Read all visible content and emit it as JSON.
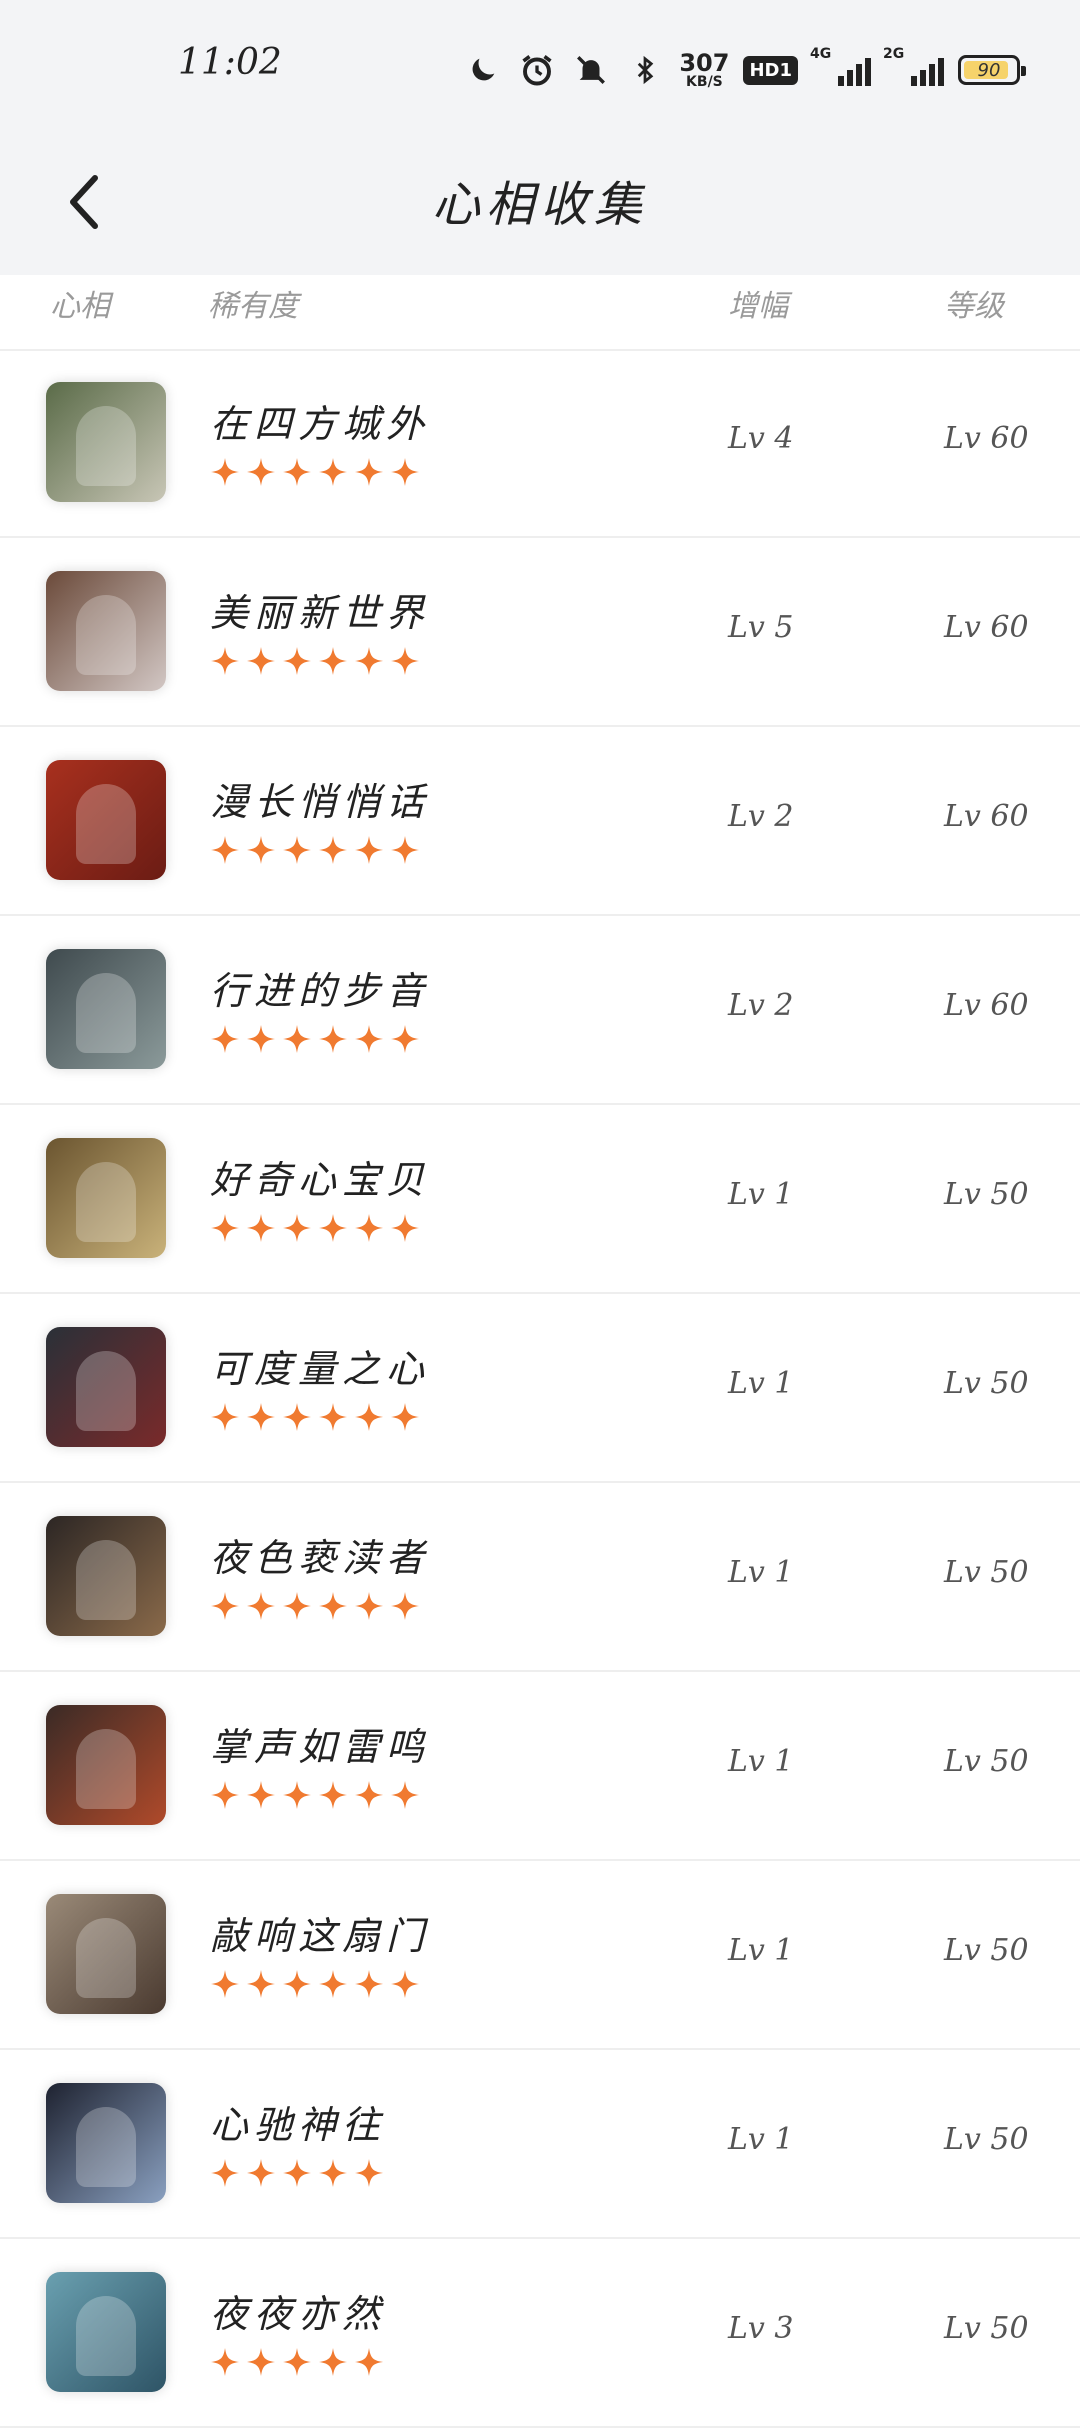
{
  "status_bar": {
    "time": "11:02",
    "net_speed_value": "307",
    "net_speed_unit": "KB/S",
    "hd_label": "HD1",
    "signal1_label": "4G",
    "signal2_label": "2G",
    "battery": "90"
  },
  "header": {
    "title": "心相收集"
  },
  "columns": {
    "icon": "心相",
    "rarity": "稀有度",
    "boost": "增幅",
    "level": "等级"
  },
  "star_color": "#f07a30",
  "items": [
    {
      "name": "在四方城外",
      "stars": 6,
      "boost": "Lv 4",
      "level": "Lv 60",
      "avatar_colors": [
        "#5a6b48",
        "#c8c6b6"
      ]
    },
    {
      "name": "美丽新世界",
      "stars": 6,
      "boost": "Lv 5",
      "level": "Lv 60",
      "avatar_colors": [
        "#6b4a3a",
        "#d2c7c4"
      ]
    },
    {
      "name": "漫长悄悄话",
      "stars": 6,
      "boost": "Lv 2",
      "level": "Lv 60",
      "avatar_colors": [
        "#a8301e",
        "#6b1c14"
      ]
    },
    {
      "name": "行进的步音",
      "stars": 6,
      "boost": "Lv 2",
      "level": "Lv 60",
      "avatar_colors": [
        "#3f4a4e",
        "#8b9a9a"
      ]
    },
    {
      "name": "好奇心宝贝",
      "stars": 6,
      "boost": "Lv 1",
      "level": "Lv 50",
      "avatar_colors": [
        "#6b5530",
        "#c9b27a"
      ]
    },
    {
      "name": "可度量之心",
      "stars": 6,
      "boost": "Lv 1",
      "level": "Lv 50",
      "avatar_colors": [
        "#2a3038",
        "#7a2a2a"
      ]
    },
    {
      "name": "夜色亵渎者",
      "stars": 6,
      "boost": "Lv 1",
      "level": "Lv 50",
      "avatar_colors": [
        "#2c2624",
        "#8a6a4a"
      ]
    },
    {
      "name": "掌声如雷鸣",
      "stars": 6,
      "boost": "Lv 1",
      "level": "Lv 50",
      "avatar_colors": [
        "#3a2a26",
        "#b04a2a"
      ]
    },
    {
      "name": "敲响这扇门",
      "stars": 6,
      "boost": "Lv 1",
      "level": "Lv 50",
      "avatar_colors": [
        "#9a8a78",
        "#4a3a30"
      ]
    },
    {
      "name": "心驰神往",
      "stars": 5,
      "boost": "Lv 1",
      "level": "Lv 50",
      "avatar_colors": [
        "#1e2230",
        "#8aa0c0"
      ]
    },
    {
      "name": "夜夜亦然",
      "stars": 5,
      "boost": "Lv 3",
      "level": "Lv 50",
      "avatar_colors": [
        "#6aa0b0",
        "#2e5466"
      ]
    }
  ]
}
